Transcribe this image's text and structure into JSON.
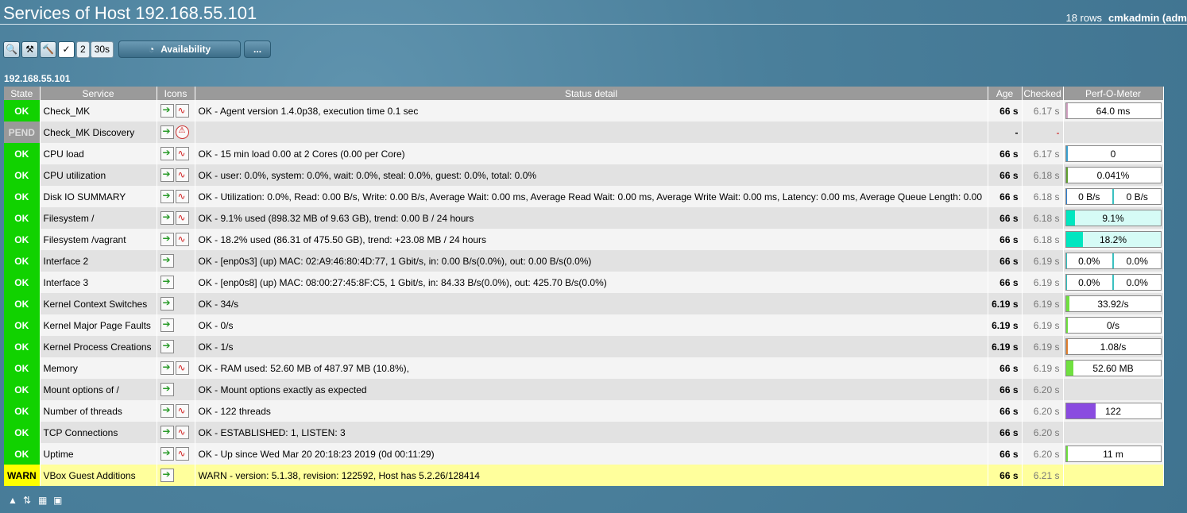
{
  "page": {
    "title": "Services of Host 192.168.55.101",
    "rows_count": "18 rows",
    "user": "cmkadmin (adm"
  },
  "toolbar": {
    "refresh_count": "2",
    "refresh_interval": "30s",
    "availability_label": "Availability",
    "more_label": "..."
  },
  "host_label": "192.168.55.101",
  "columns": {
    "state": "State",
    "service": "Service",
    "icons": "Icons",
    "status": "Status detail",
    "age": "Age",
    "checked": "Checked",
    "perf": "Perf-O-Meter"
  },
  "rows": [
    {
      "state": "OK",
      "service": "Check_MK",
      "icons": [
        "action",
        "graph"
      ],
      "status": "OK - Agent version 1.4.0p38, execution time 0.1 sec",
      "age": "66 s",
      "checked": "6.17 s",
      "perf": {
        "text": "64.0 ms",
        "fraction": 0.01,
        "color": "#d0a0c0"
      }
    },
    {
      "state": "PEND",
      "service": "Check_MK Discovery",
      "icons": [
        "action",
        "disc"
      ],
      "status": "",
      "age": "-",
      "checked": "-",
      "perf": null
    },
    {
      "state": "OK",
      "service": "CPU load",
      "icons": [
        "action",
        "graph"
      ],
      "status": "OK - 15 min load 0.00 at 2 Cores (0.00 per Core)",
      "age": "66 s",
      "checked": "6.17 s",
      "perf": {
        "text": "0",
        "fraction": 0.01,
        "color": "#3aa0d0"
      }
    },
    {
      "state": "OK",
      "service": "CPU utilization",
      "icons": [
        "action",
        "graph"
      ],
      "status": "OK - user: 0.0%, system: 0.0%, wait: 0.0%, steal: 0.0%, guest: 0.0%, total: 0.0%",
      "age": "66 s",
      "checked": "6.18 s",
      "perf": {
        "text": "0.041%",
        "fraction": 0.02,
        "color": "#60a030"
      }
    },
    {
      "state": "OK",
      "service": "Disk IO SUMMARY",
      "icons": [
        "action",
        "graph"
      ],
      "status": "OK - Utilization: 0.0%, Read: 0.00 B/s, Write: 0.00 B/s, Average Wait: 0.00 ms, Average Read Wait: 0.00 ms, Average Write Wait: 0.00 ms, Latency: 0.00 ms, Average Queue Length: 0.00",
      "age": "66 s",
      "checked": "6.18 s",
      "perf": {
        "split": [
          "0 B/s",
          "0 B/s"
        ],
        "color": "#3080d0"
      }
    },
    {
      "state": "OK",
      "service": "Filesystem /",
      "icons": [
        "action",
        "graph"
      ],
      "status": "OK - 9.1% used (898.32 MB of 9.63 GB), trend: 0.00 B / 24 hours",
      "age": "66 s",
      "checked": "6.18 s",
      "perf": {
        "text": "9.1%",
        "fraction": 0.091,
        "color": "#00e6c0",
        "bg": "#d6fbf6"
      }
    },
    {
      "state": "OK",
      "service": "Filesystem /vagrant",
      "icons": [
        "action",
        "graph"
      ],
      "status": "OK - 18.2% used (86.31 of 475.50 GB), trend: +23.08 MB / 24 hours",
      "age": "66 s",
      "checked": "6.18 s",
      "perf": {
        "text": "18.2%",
        "fraction": 0.182,
        "color": "#00e6c0",
        "bg": "#d6fbf6"
      }
    },
    {
      "state": "OK",
      "service": "Interface 2",
      "icons": [
        "action"
      ],
      "status": "OK - [enp0s3] (up) MAC: 02:A9:46:80:4D:77, 1 Gbit/s, in: 0.00 B/s(0.0%), out: 0.00 B/s(0.0%)",
      "age": "66 s",
      "checked": "6.19 s",
      "perf": {
        "split": [
          "0.0%",
          "0.0%"
        ],
        "color": "#30c0c0"
      }
    },
    {
      "state": "OK",
      "service": "Interface 3",
      "icons": [
        "action"
      ],
      "status": "OK - [enp0s8] (up) MAC: 08:00:27:45:8F:C5, 1 Gbit/s, in: 84.33 B/s(0.0%), out: 425.70 B/s(0.0%)",
      "age": "66 s",
      "checked": "6.19 s",
      "perf": {
        "split": [
          "0.0%",
          "0.0%"
        ],
        "color": "#30c0c0"
      }
    },
    {
      "state": "OK",
      "service": "Kernel Context Switches",
      "icons": [
        "action"
      ],
      "status": "OK - 34/s",
      "age": "6.19 s",
      "checked": "6.19 s",
      "perf": {
        "text": "33.92/s",
        "fraction": 0.03,
        "color": "#70e040"
      }
    },
    {
      "state": "OK",
      "service": "Kernel Major Page Faults",
      "icons": [
        "action"
      ],
      "status": "OK - 0/s",
      "age": "6.19 s",
      "checked": "6.19 s",
      "perf": {
        "text": "0/s",
        "fraction": 0.01,
        "color": "#70e040"
      }
    },
    {
      "state": "OK",
      "service": "Kernel Process Creations",
      "icons": [
        "action"
      ],
      "status": "OK - 1/s",
      "age": "6.19 s",
      "checked": "6.19 s",
      "perf": {
        "text": "1.08/s",
        "fraction": 0.02,
        "color": "#e08030"
      }
    },
    {
      "state": "OK",
      "service": "Memory",
      "icons": [
        "action",
        "graph"
      ],
      "status": "OK - RAM used: 52.60 MB of 487.97 MB (10.8%),",
      "age": "66 s",
      "checked": "6.19 s",
      "perf": {
        "text": "52.60 MB",
        "fraction": 0.08,
        "color": "#70e040"
      }
    },
    {
      "state": "OK",
      "service": "Mount options of /",
      "icons": [
        "action"
      ],
      "status": "OK - Mount options exactly as expected",
      "age": "66 s",
      "checked": "6.20 s",
      "perf": null
    },
    {
      "state": "OK",
      "service": "Number of threads",
      "icons": [
        "action",
        "graph"
      ],
      "status": "OK - 122 threads",
      "age": "66 s",
      "checked": "6.20 s",
      "perf": {
        "text": "122",
        "fraction": 0.32,
        "color": "#8a4be0"
      }
    },
    {
      "state": "OK",
      "service": "TCP Connections",
      "icons": [
        "action",
        "graph"
      ],
      "status": "OK - ESTABLISHED: 1, LISTEN: 3",
      "age": "66 s",
      "checked": "6.20 s",
      "perf": null
    },
    {
      "state": "OK",
      "service": "Uptime",
      "icons": [
        "action",
        "graph"
      ],
      "status": "OK - Up since Wed Mar 20 20:18:23 2019 (0d 00:11:29)",
      "age": "66 s",
      "checked": "6.20 s",
      "perf": {
        "text": "11 m",
        "fraction": 0.02,
        "color": "#70e040"
      }
    },
    {
      "state": "WARN",
      "service": "VBox Guest Additions",
      "icons": [
        "action"
      ],
      "status": "WARN - version: 5.1.38, revision: 122592, Host has 5.2.26/128414",
      "age": "66 s",
      "checked": "6.21 s",
      "perf": null
    }
  ]
}
